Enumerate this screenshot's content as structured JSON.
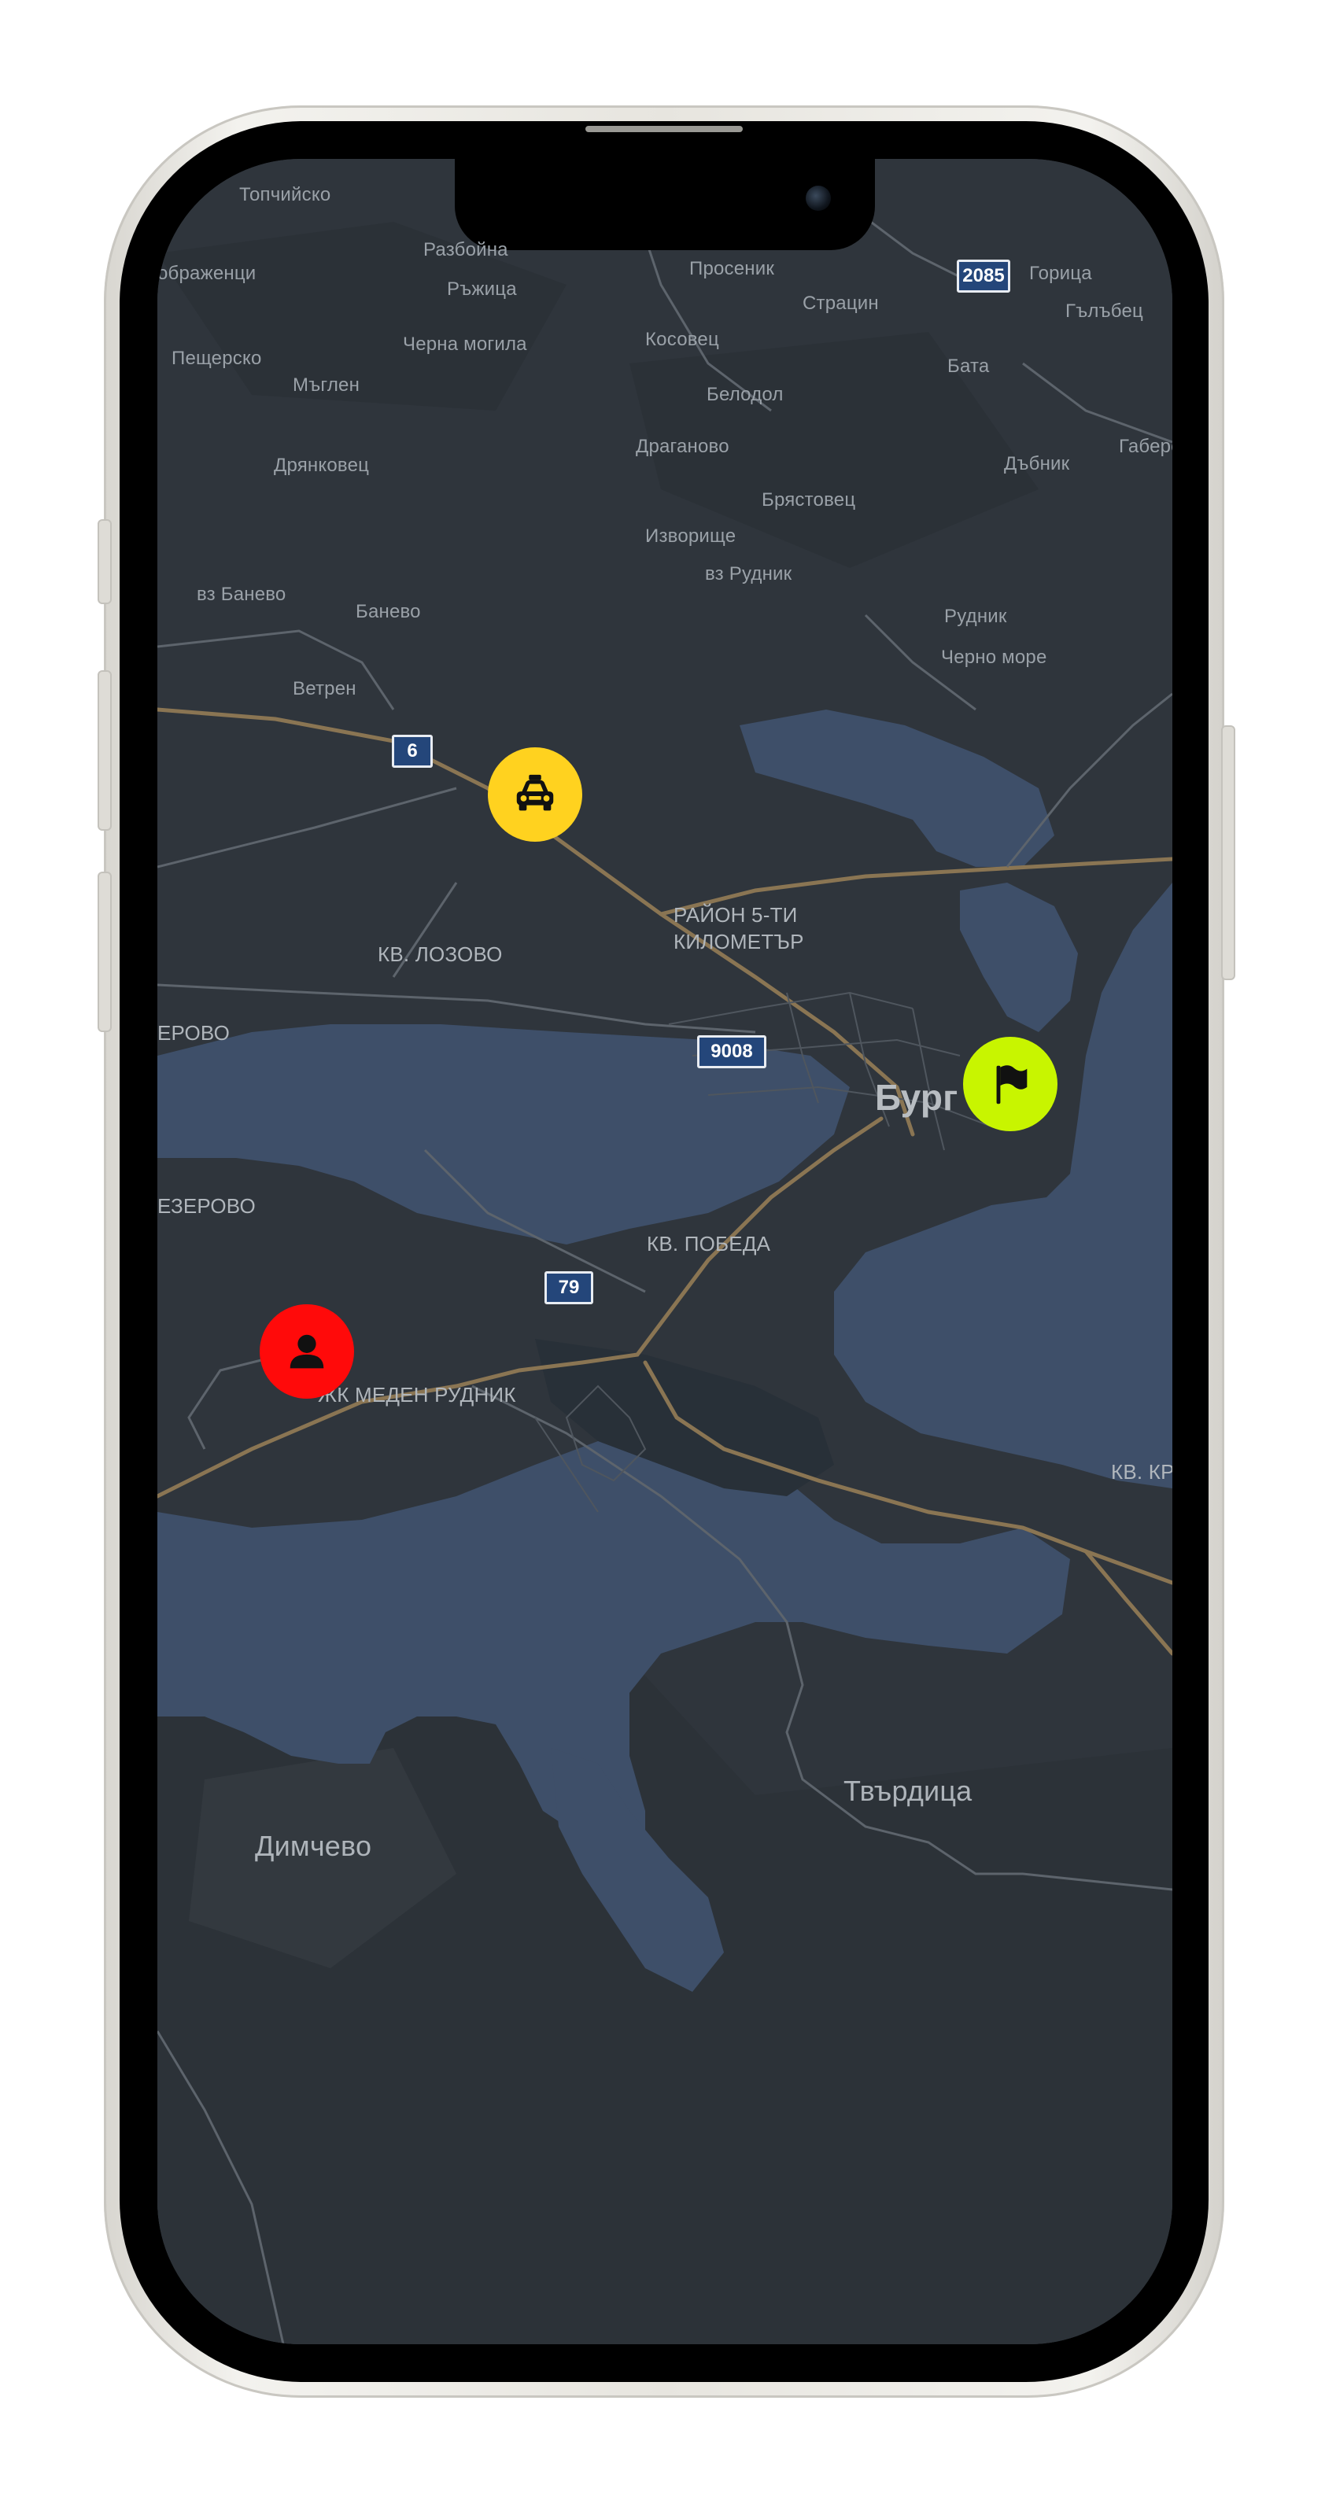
{
  "map": {
    "labels": {
      "topchiysko": "Топчийско",
      "razboyna": "Разбойна",
      "preobrazhentsi": "ображенци",
      "razhitsa": "Ръжица",
      "prosenik": "Просеник",
      "gorica": "Горица",
      "stratsin": "Страцин",
      "galabets": "Гълъбец",
      "peshtersko": "Пещерско",
      "cherna_mogila": "Черна могила",
      "kosovets": "Косовец",
      "bata": "Бата",
      "maglen": "Мъглен",
      "belodol": "Белодол",
      "draganovo": "Драганово",
      "dabnik": "Дъбник",
      "gabero": "Габеро",
      "dryankovets": "Дрянковец",
      "bryastovets": "Брястовец",
      "izvorishte": "Изворище",
      "vz_rudnik": "вз Рудник",
      "vz_banevo": "вз Банево",
      "banevo": "Банево",
      "rudnik": "Рудник",
      "cherno_more": "Черно море",
      "vetren": "Ветрен",
      "rayon_1": "РАЙОН 5-ТИ",
      "rayon_2": "КИЛОМЕТЪР",
      "kv_lozovo": "КВ. ЛОЗОВО",
      "erovo": "ЕРОВО",
      "burgas": "Бург",
      "ezerovo": "ЕЗЕРОВО",
      "kv_pobeda": "КВ. ПОБЕДА",
      "meden_rudnik": "ЖК МЕДЕН РУДНИК",
      "kv_kr": "КВ. КР",
      "tvarditsa": "Твърдица",
      "dimchevo": "Димчево"
    },
    "shields": {
      "road_2085": "2085",
      "road_6": "6",
      "road_9008": "9008",
      "road_79": "79"
    },
    "markers": {
      "taxi": {
        "icon": "taxi-icon",
        "color": "#FFD21F"
      },
      "destination": {
        "icon": "flag-icon",
        "color": "#C8F500"
      },
      "user": {
        "icon": "person-icon",
        "color": "#FF0A0A"
      }
    }
  }
}
